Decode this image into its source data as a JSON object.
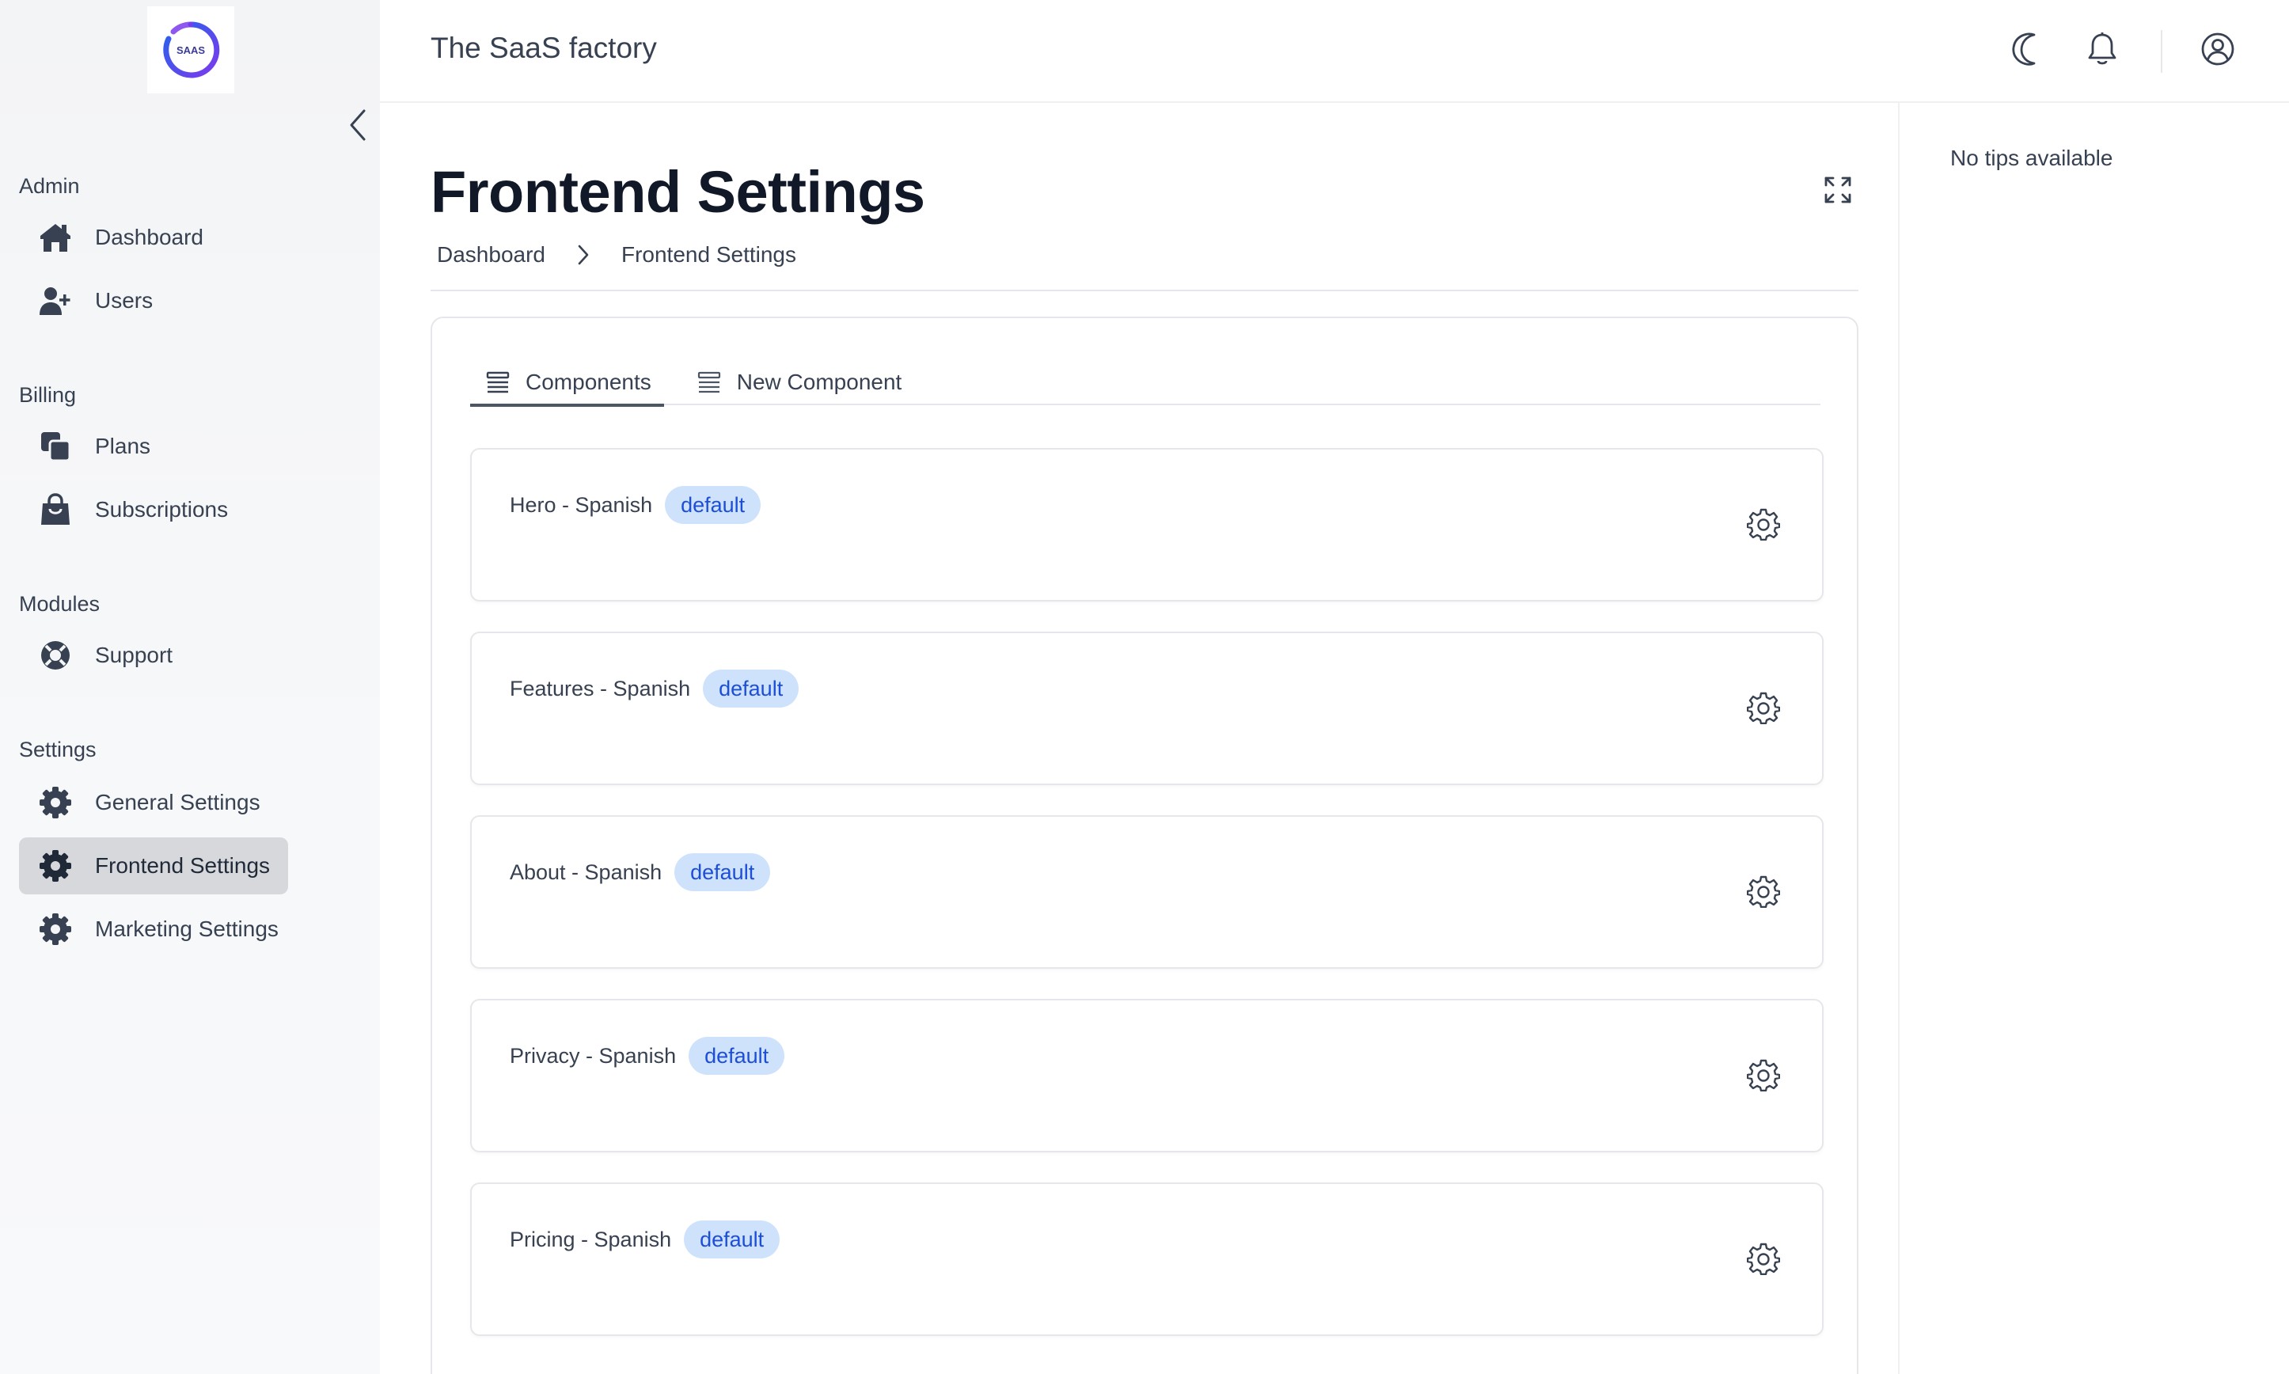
{
  "app": {
    "title": "The SaaS factory",
    "logo_text": "SAAS"
  },
  "sidebar": {
    "sections": [
      {
        "label": "Admin",
        "items": [
          {
            "label": "Dashboard",
            "icon": "home-icon"
          },
          {
            "label": "Users",
            "icon": "user-plus-icon"
          }
        ]
      },
      {
        "label": "Billing",
        "items": [
          {
            "label": "Plans",
            "icon": "stack-icon"
          },
          {
            "label": "Subscriptions",
            "icon": "shopping-bag-icon"
          }
        ]
      },
      {
        "label": "Modules",
        "items": [
          {
            "label": "Support",
            "icon": "lifebuoy-icon"
          }
        ]
      },
      {
        "label": "Settings",
        "items": [
          {
            "label": "General Settings",
            "icon": "gear-icon"
          },
          {
            "label": "Frontend Settings",
            "icon": "gear-icon",
            "active": true
          },
          {
            "label": "Marketing Settings",
            "icon": "gear-icon"
          }
        ]
      }
    ]
  },
  "topbar": {
    "icons": [
      "moon-icon",
      "bell-icon",
      "user-circle-icon"
    ]
  },
  "page": {
    "title": "Frontend Settings",
    "breadcrumb": [
      "Dashboard",
      "Frontend Settings"
    ]
  },
  "tabs": [
    {
      "label": "Components",
      "active": true
    },
    {
      "label": "New Component",
      "active": false
    }
  ],
  "components": [
    {
      "name": "Hero - Spanish",
      "badge": "default"
    },
    {
      "name": "Features - Spanish",
      "badge": "default"
    },
    {
      "name": "About - Spanish",
      "badge": "default"
    },
    {
      "name": "Privacy - Spanish",
      "badge": "default"
    },
    {
      "name": "Pricing - Spanish",
      "badge": "default"
    }
  ],
  "tips": {
    "text": "No tips available"
  },
  "colors": {
    "badge_bg": "#cfe2fc",
    "badge_text": "#1d4ed8",
    "active_nav_bg": "#d6d8dc",
    "logo_gradient_start": "#2563eb",
    "logo_gradient_end": "#7c3aed"
  }
}
